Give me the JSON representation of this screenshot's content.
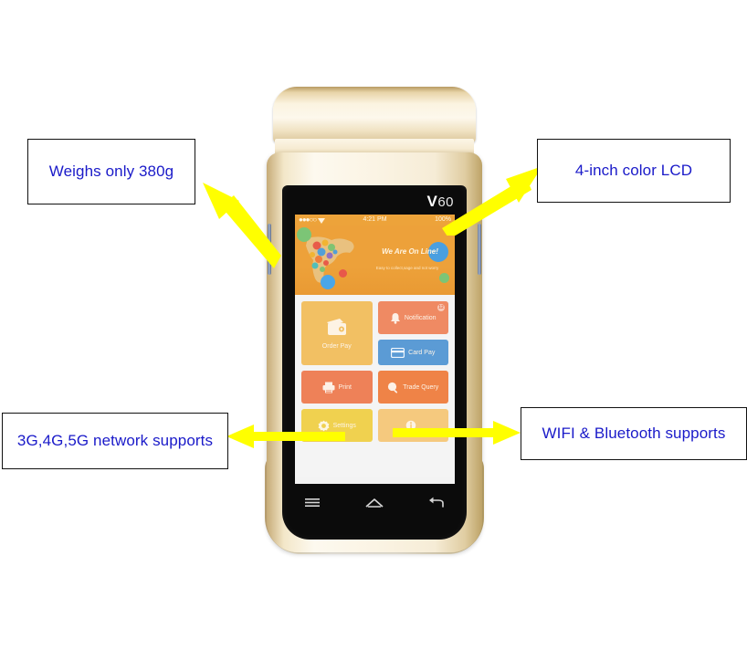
{
  "scene": {
    "background_color": "#ffffff",
    "accent_arrow_color": "#ffff00",
    "callout_text_color": "#1a1ac9",
    "callout_border_color": "#111111"
  },
  "callouts": [
    {
      "id": "weight",
      "text": "Weighs only 380g",
      "position": "top-left"
    },
    {
      "id": "lcd",
      "text": "4-inch color LCD",
      "position": "top-right"
    },
    {
      "id": "network",
      "text": "3G,4G,5G network supports",
      "position": "bottom-left"
    },
    {
      "id": "wifi",
      "text": "WIFI & Bluetooth supports",
      "position": "bottom-right"
    }
  ],
  "device": {
    "brand_mark": "V",
    "model": "60",
    "body_color": "#fbf4e4",
    "glass_color": "#0b0b0b",
    "side_buttons": [
      "left-power-button",
      "right-volume-button"
    ]
  },
  "screen": {
    "status_bar": {
      "signal_icon": "signal-dots-icon",
      "wifi_icon": "wifi-icon",
      "time": "4:21 PM",
      "battery": "100%"
    },
    "banner": {
      "title": "We Are On Line!",
      "subtitle": "Easy to collect,sage and not worry",
      "background_color": "#eda13a",
      "graphic": "world-map-bubbles"
    },
    "tiles": [
      {
        "id": "order-pay",
        "label": "Order Pay",
        "icon": "wallet-icon",
        "color": "#f2c063",
        "size": "tall",
        "badge": ""
      },
      {
        "id": "notification",
        "label": "Notification",
        "icon": "bell-icon",
        "color": "#ef8a63",
        "size": "wide",
        "badge": "12"
      },
      {
        "id": "card-pay",
        "label": "Card Pay",
        "icon": "credit-card-icon",
        "color": "#5b9bd5",
        "size": "wide",
        "badge": ""
      },
      {
        "id": "print",
        "label": "Print",
        "icon": "printer-icon",
        "color": "#ee8158",
        "size": "wide",
        "badge": ""
      },
      {
        "id": "trade-query",
        "label": "Trade Query",
        "icon": "search-icon",
        "color": "#ef8347",
        "size": "wide",
        "badge": ""
      },
      {
        "id": "settings",
        "label": "Settings",
        "icon": "gear-icon",
        "color": "#f0d14f",
        "size": "wide",
        "badge": ""
      },
      {
        "id": "more",
        "label": "",
        "icon": "info-icon",
        "color": "#f5c97e",
        "size": "wide",
        "badge": ""
      }
    ],
    "nav_bar": {
      "menu_icon": "menu-icon",
      "home_icon": "home-icon",
      "back_icon": "back-icon"
    }
  }
}
